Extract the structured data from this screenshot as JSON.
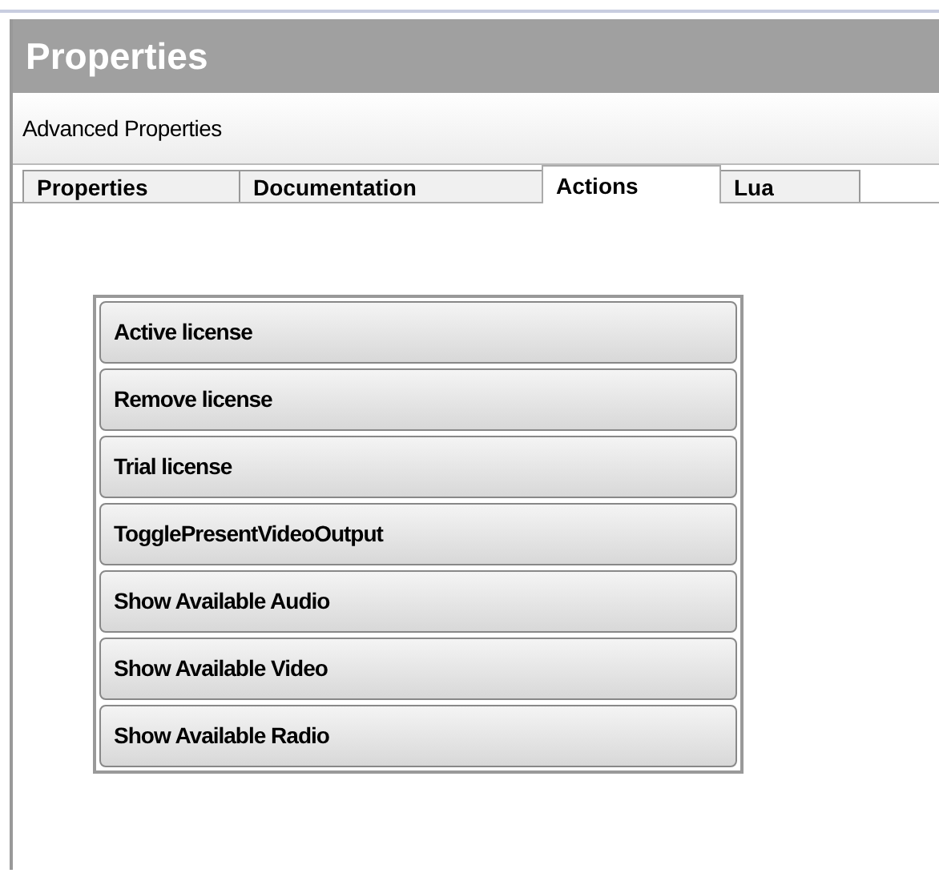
{
  "panel": {
    "title": "Properties",
    "subtitle": "Advanced Properties"
  },
  "tabs": [
    {
      "label": "Properties",
      "selected": false
    },
    {
      "label": "Documentation",
      "selected": false
    },
    {
      "label": "Actions",
      "selected": true
    },
    {
      "label": "Lua",
      "selected": false
    }
  ],
  "actions": [
    "Active license",
    "Remove license",
    "Trial license",
    "TogglePresentVideoOutput",
    "Show Available Audio",
    "Show Available Video",
    "Show Available Radio"
  ]
}
